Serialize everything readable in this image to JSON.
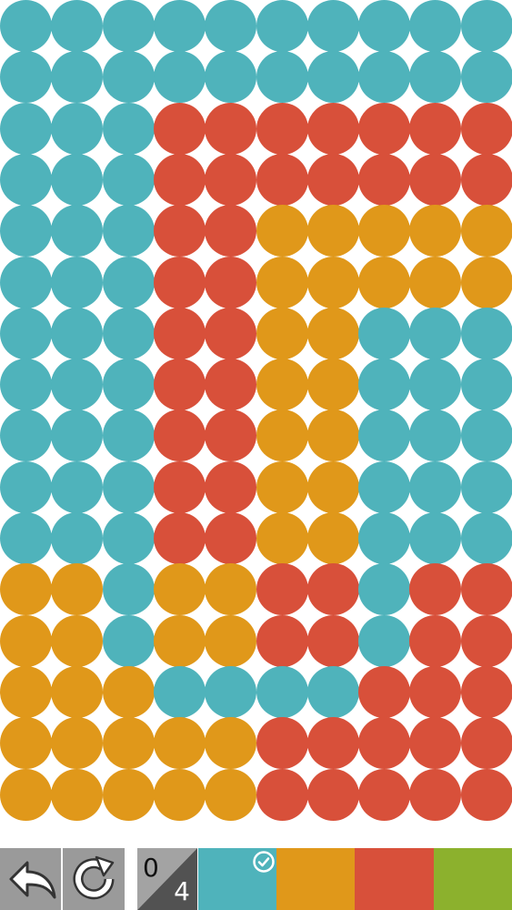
{
  "palette": {
    "teal": "#4fb3bb",
    "red": "#d8503a",
    "orange": "#e0981a",
    "green": "#8cb12d"
  },
  "board": {
    "columns": 10,
    "rows": 16,
    "grid": [
      [
        "teal",
        "teal",
        "teal",
        "teal",
        "teal",
        "teal",
        "teal",
        "teal",
        "teal",
        "teal"
      ],
      [
        "teal",
        "teal",
        "teal",
        "teal",
        "teal",
        "teal",
        "teal",
        "teal",
        "teal",
        "teal"
      ],
      [
        "teal",
        "teal",
        "teal",
        "red",
        "red",
        "red",
        "red",
        "red",
        "red",
        "red"
      ],
      [
        "teal",
        "teal",
        "teal",
        "red",
        "red",
        "red",
        "red",
        "red",
        "red",
        "red"
      ],
      [
        "teal",
        "teal",
        "teal",
        "red",
        "red",
        "orange",
        "orange",
        "orange",
        "orange",
        "orange"
      ],
      [
        "teal",
        "teal",
        "teal",
        "red",
        "red",
        "orange",
        "orange",
        "orange",
        "orange",
        "orange"
      ],
      [
        "teal",
        "teal",
        "teal",
        "red",
        "red",
        "orange",
        "orange",
        "teal",
        "teal",
        "teal"
      ],
      [
        "teal",
        "teal",
        "teal",
        "red",
        "red",
        "orange",
        "orange",
        "teal",
        "teal",
        "teal"
      ],
      [
        "teal",
        "teal",
        "teal",
        "red",
        "red",
        "orange",
        "orange",
        "teal",
        "teal",
        "teal"
      ],
      [
        "teal",
        "teal",
        "teal",
        "red",
        "red",
        "orange",
        "orange",
        "teal",
        "teal",
        "teal"
      ],
      [
        "teal",
        "teal",
        "teal",
        "red",
        "red",
        "orange",
        "orange",
        "teal",
        "teal",
        "teal"
      ],
      [
        "orange",
        "orange",
        "teal",
        "orange",
        "orange",
        "red",
        "red",
        "teal",
        "red",
        "red"
      ],
      [
        "orange",
        "orange",
        "teal",
        "orange",
        "orange",
        "red",
        "red",
        "teal",
        "red",
        "red"
      ],
      [
        "orange",
        "orange",
        "orange",
        "teal",
        "teal",
        "teal",
        "teal",
        "red",
        "red",
        "red"
      ],
      [
        "orange",
        "orange",
        "orange",
        "orange",
        "orange",
        "red",
        "red",
        "red",
        "red",
        "red"
      ],
      [
        "orange",
        "orange",
        "orange",
        "orange",
        "orange",
        "red",
        "red",
        "red",
        "red",
        "red"
      ]
    ]
  },
  "toolbar": {
    "undo_icon": "undo-arrow-icon",
    "restart_icon": "restart-icon",
    "moves_used": "0",
    "moves_limit": "4",
    "selected_color": "teal",
    "selected_indicator_icon": "check-circle-icon",
    "color_buttons": [
      "teal",
      "orange",
      "red",
      "green"
    ]
  }
}
